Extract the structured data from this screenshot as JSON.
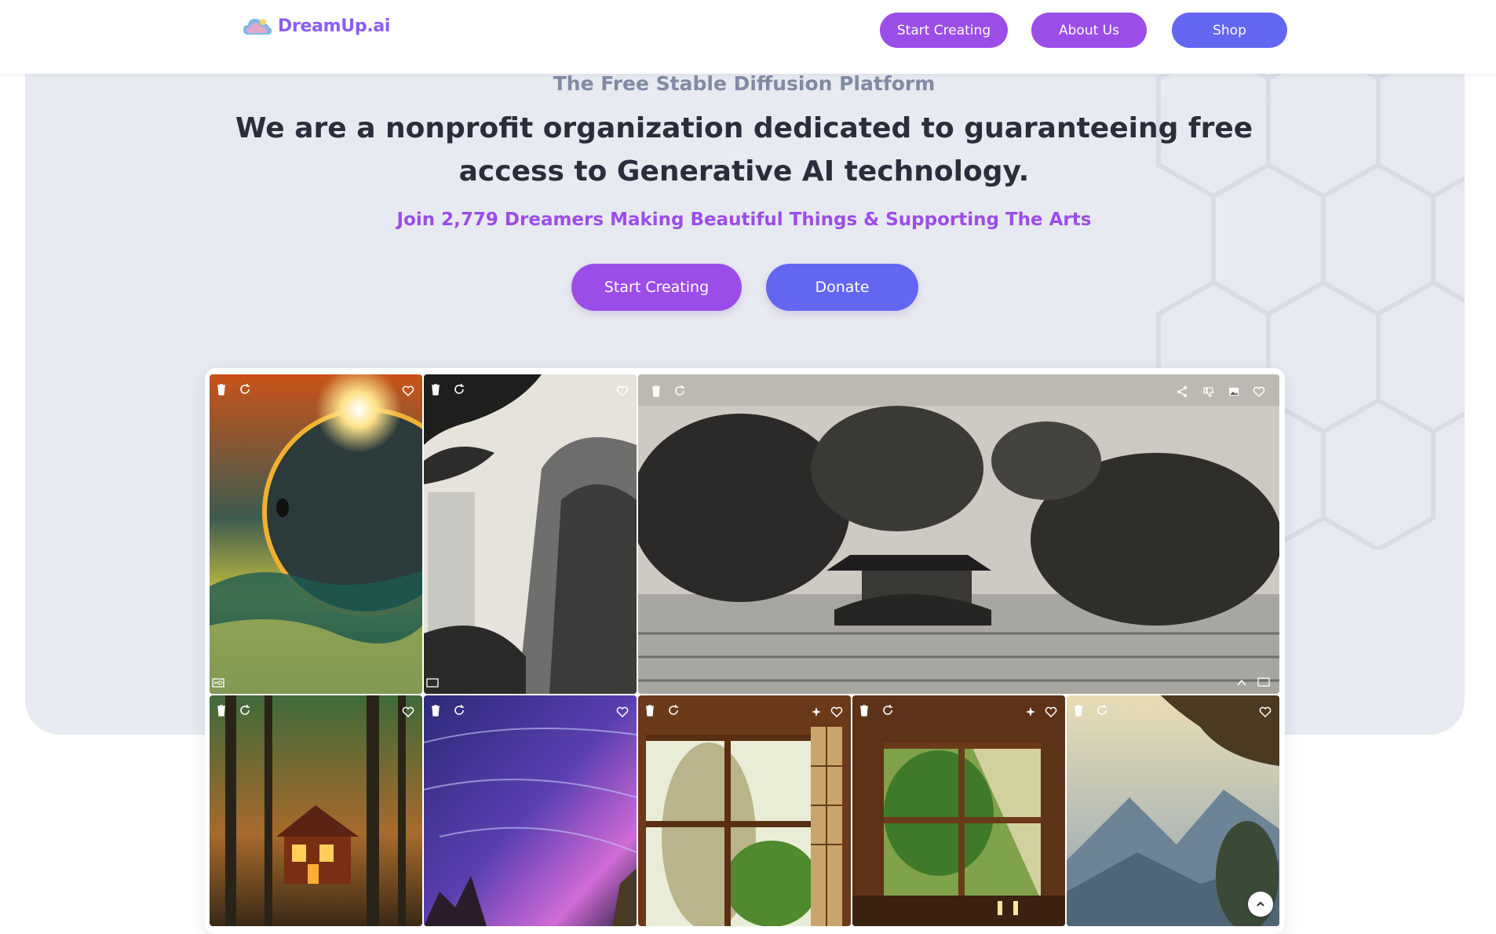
{
  "header": {
    "logo_text": "DreamUp.ai",
    "nav": [
      {
        "label": "Start Creating"
      },
      {
        "label": "About Us"
      },
      {
        "label": "Shop"
      }
    ]
  },
  "hero": {
    "subtitle": "The Free Stable Diffusion Platform",
    "headline": "We are a nonprofit organization dedicated to guaranteeing free access to Generative AI technology.",
    "tagline": "Join 2,779 Dreamers Making Beautiful Things & Supporting The Arts",
    "primary_cta": "Start Creating",
    "secondary_cta": "Donate"
  },
  "colors": {
    "brand_purple": "#9b4de8",
    "brand_indigo": "#6366f1",
    "hero_bg": "#e8eaf1",
    "headline": "#2a2e3b"
  },
  "gallery": {
    "images": [
      {
        "subject": "eclipse planet over glowing sea",
        "icons": [
          "trash-icon",
          "regenerate-icon",
          "heart-icon",
          "hd-badge-icon"
        ]
      },
      {
        "subject": "ink wash waterfall with pine",
        "icons": [
          "trash-icon",
          "regenerate-icon",
          "heart-icon",
          "hd-badge-icon"
        ]
      },
      {
        "subject": "ink drawing of pagoda by lake with trees",
        "icons": [
          "trash-icon",
          "regenerate-icon",
          "share-icon",
          "dislike-icon",
          "image-icon",
          "heart-icon",
          "hd-badge-icon"
        ]
      },
      {
        "subject": "glowing cabin in misty forest",
        "icons": [
          "trash-icon",
          "regenerate-icon",
          "heart-icon"
        ]
      },
      {
        "subject": "purple galaxy brushstrokes",
        "icons": [
          "trash-icon",
          "regenerate-icon",
          "heart-icon"
        ]
      },
      {
        "subject": "japanese room window with tree",
        "icons": [
          "trash-icon",
          "regenerate-icon",
          "sparkle-icon",
          "heart-icon"
        ]
      },
      {
        "subject": "sunlit window with plants",
        "icons": [
          "trash-icon",
          "regenerate-icon",
          "sparkle-icon",
          "heart-icon"
        ]
      },
      {
        "subject": "hazy mountains with tree",
        "icons": [
          "trash-icon",
          "regenerate-icon",
          "heart-icon"
        ]
      }
    ]
  }
}
